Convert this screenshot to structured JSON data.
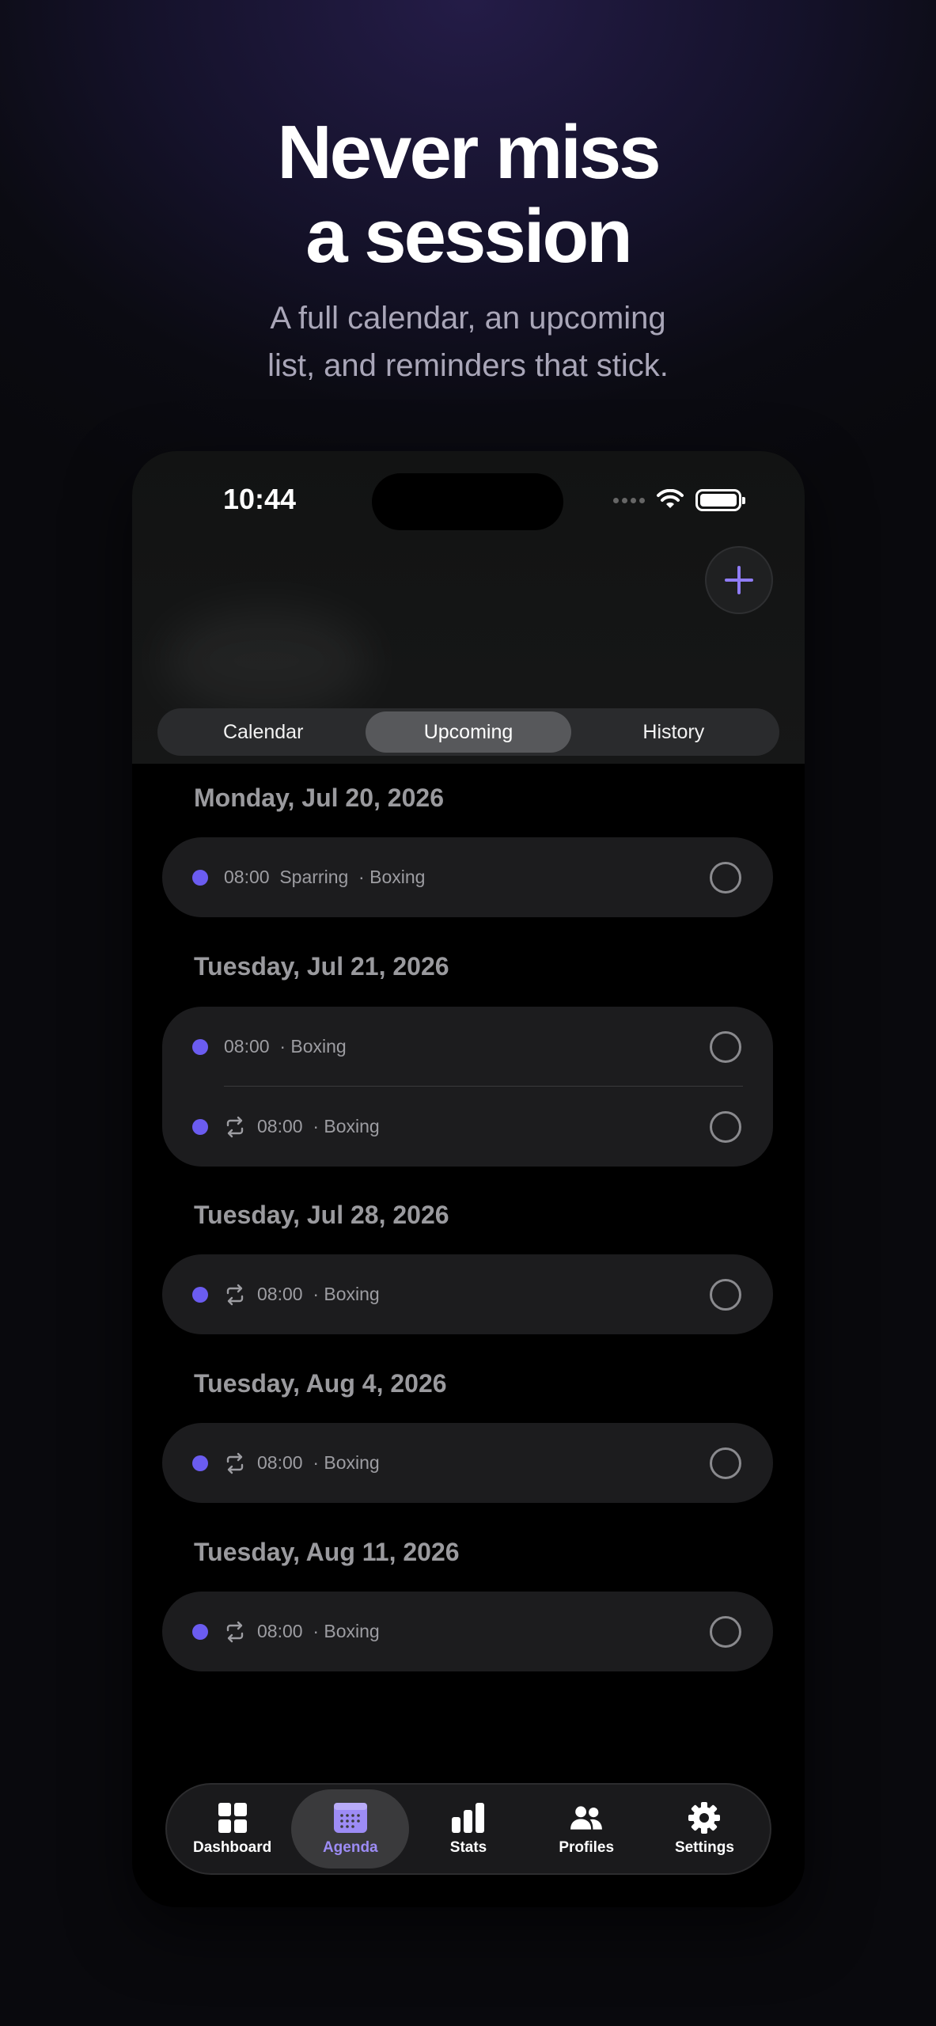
{
  "hero": {
    "title_line1": "Never miss",
    "title_line2": "a session",
    "subtitle_line1": "A full calendar, an upcoming",
    "subtitle_line2": "list, and reminders that stick."
  },
  "status_bar": {
    "time": "10:44"
  },
  "segments": [
    {
      "label": "Calendar",
      "active": false
    },
    {
      "label": "Upcoming",
      "active": true
    },
    {
      "label": "History",
      "active": false
    }
  ],
  "sections": [
    {
      "date": "Monday, Jul 20, 2026",
      "items": [
        {
          "repeat": false,
          "text": "08:00  Sparring  · Boxing"
        }
      ]
    },
    {
      "date": "Tuesday, Jul 21, 2026",
      "items": [
        {
          "repeat": false,
          "text": "08:00  · Boxing"
        },
        {
          "repeat": true,
          "text": "08:00  · Boxing"
        }
      ]
    },
    {
      "date": "Tuesday, Jul 28, 2026",
      "items": [
        {
          "repeat": true,
          "text": "08:00  · Boxing"
        }
      ]
    },
    {
      "date": "Tuesday, Aug 4, 2026",
      "items": [
        {
          "repeat": true,
          "text": "08:00  · Boxing"
        }
      ]
    },
    {
      "date": "Tuesday, Aug 11, 2026",
      "items": [
        {
          "repeat": true,
          "text": "08:00  · Boxing"
        }
      ]
    }
  ],
  "tabs": [
    {
      "label": "Dashboard",
      "icon": "grid-icon",
      "active": false
    },
    {
      "label": "Agenda",
      "icon": "calendar-icon",
      "active": true
    },
    {
      "label": "Stats",
      "icon": "bar-chart-icon",
      "active": false
    },
    {
      "label": "Profiles",
      "icon": "people-icon",
      "active": false
    },
    {
      "label": "Settings",
      "icon": "gear-icon",
      "active": false
    }
  ],
  "colors": {
    "accent": "#6b5cf0",
    "tab_active": "#9d8cf5"
  }
}
